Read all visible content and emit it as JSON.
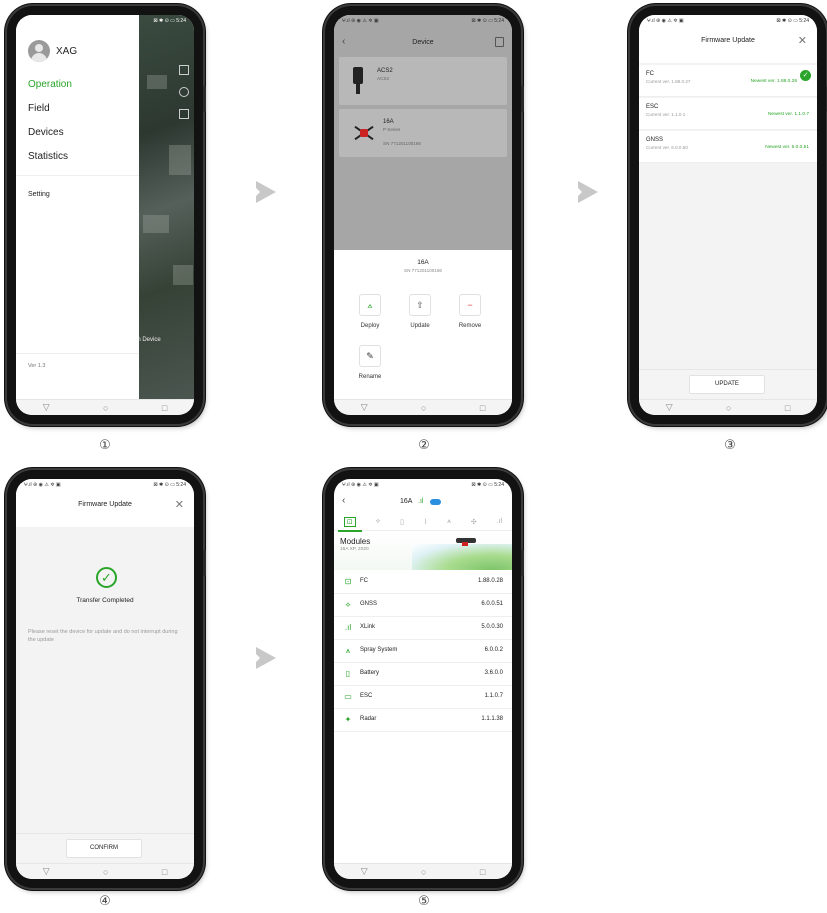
{
  "status_bar": {
    "left": "ⵖ.ıl ⊛ ◉ ⚠ ✲ ▣",
    "right": "⊠ ✱ ⊙ ▭ 5:24"
  },
  "nav_bar": {
    "back": "▽",
    "home": "○",
    "recent": "□"
  },
  "step_labels": [
    "①",
    "②",
    "③",
    "④",
    "⑤"
  ],
  "screen1": {
    "username": "XAG",
    "menu": [
      "Operation",
      "Field",
      "Devices",
      "Statistics"
    ],
    "setting": "Setting",
    "version": "Ver 1.3",
    "map_fragment": "in Device",
    "accent": "#2aa52a"
  },
  "screen2": {
    "title": "Device",
    "devices": [
      {
        "name": "ACS2",
        "model": "ACS2",
        "sn": ""
      },
      {
        "name": "16A",
        "model": "P Series",
        "sn": "SN 771201100166"
      }
    ],
    "sheet": {
      "name": "16A",
      "sn": "SN 771201100166",
      "actions": [
        "Deploy",
        "Update",
        "Remove",
        "Rename"
      ]
    }
  },
  "screen3": {
    "title": "Firmware Update",
    "rows": [
      {
        "name": "FC",
        "current": "Current ver. 1.88.0.27",
        "newest": "Newest ver. 1.88.0.28"
      },
      {
        "name": "ESC",
        "current": "Current ver. 1.1.0.1",
        "newest": "Newest ver. 1.1.0.7"
      },
      {
        "name": "GNSS",
        "current": "Current ver. 6.0.0.50",
        "newest": "Newest ver. 6.0.0.51"
      }
    ],
    "button": "UPDATE"
  },
  "screen4": {
    "title": "Firmware Update",
    "message": "Transfer Completed",
    "note": "Please reset the device for update and do not interrupt during the update",
    "button": "CONFIRM"
  },
  "screen5": {
    "device": "16A",
    "heading": "Modules",
    "subheading": "16A XP, 2020",
    "modules": [
      {
        "icon": "fc-icon",
        "name": "FC",
        "version": "1.88.0.28"
      },
      {
        "icon": "gnss-icon",
        "name": "GNSS",
        "version": "6.0.0.51"
      },
      {
        "icon": "xlink-icon",
        "name": "XLink",
        "version": "5.0.0.30"
      },
      {
        "icon": "spray-icon",
        "name": "Spray System",
        "version": "6.0.0.2"
      },
      {
        "icon": "battery-icon",
        "name": "Battery",
        "version": "3.6.0.0"
      },
      {
        "icon": "esc-icon",
        "name": "ESC",
        "version": "1.1.0.7"
      },
      {
        "icon": "radar-icon",
        "name": "Radar",
        "version": "1.1.1.38"
      }
    ]
  }
}
